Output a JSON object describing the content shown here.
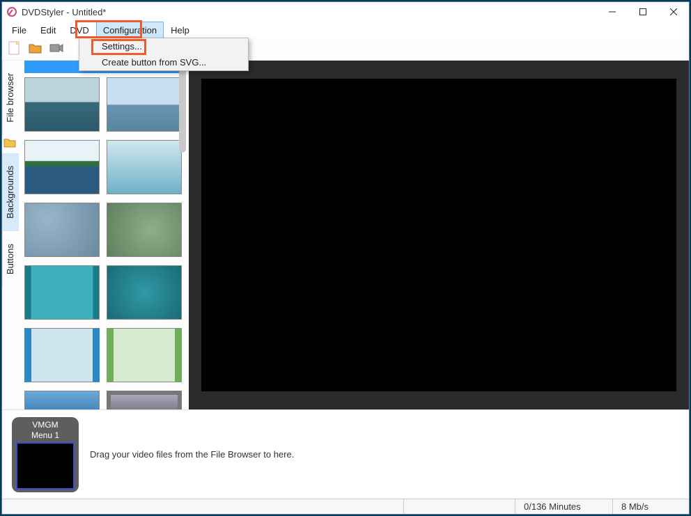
{
  "title": "DVDStyler - Untitled*",
  "menubar": {
    "file": "File",
    "edit": "Edit",
    "dvd": "DVD",
    "configuration": "Configuration",
    "help": "Help"
  },
  "config_menu": {
    "settings": "Settings...",
    "create_button": "Create button from SVG..."
  },
  "sidetabs": {
    "file_browser": "File browser",
    "backgrounds": "Backgrounds",
    "buttons": "Buttons"
  },
  "timeline": {
    "card_title": "VMGM",
    "card_sub": "Menu 1",
    "hint": "Drag your video files from the File Browser to here."
  },
  "status": {
    "minutes": "0/136 Minutes",
    "bitrate": "8 Mb/s"
  },
  "icons": {
    "new": "new-file-icon",
    "open": "open-folder-icon",
    "camera": "camera-icon"
  }
}
